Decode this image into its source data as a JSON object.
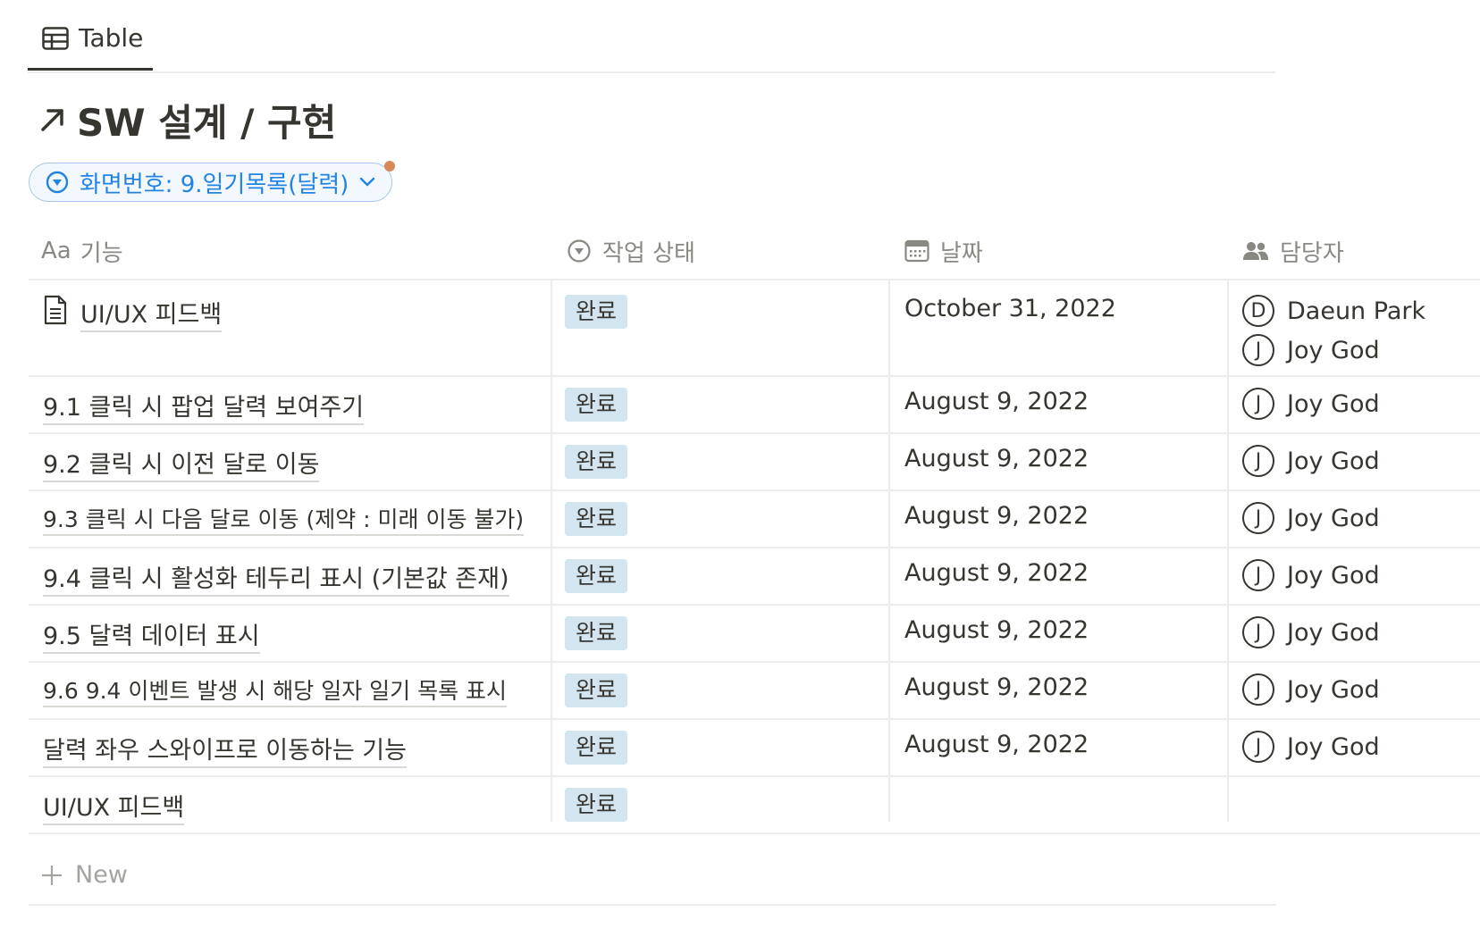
{
  "view_tab": {
    "label": "Table",
    "icon": "table-icon"
  },
  "page": {
    "title": "SW 설계 / 구현",
    "title_icon": "arrow-up-right-icon"
  },
  "filter": {
    "label": "화면번호: 9.일기목록(달력)",
    "icon": "select-circle-icon",
    "accent": "#2383e2",
    "indicator_color": "#d9885a"
  },
  "columns": [
    {
      "prefix": "Aa",
      "label": "기능",
      "icon": "title-property-icon"
    },
    {
      "label": "작업 상태",
      "icon": "status-property-icon"
    },
    {
      "label": "날짜",
      "icon": "calendar-icon"
    },
    {
      "label": "담당자",
      "icon": "people-icon"
    }
  ],
  "rows": [
    {
      "name": "UI/UX 피드백",
      "has_page_icon": true,
      "status": "완료",
      "date": "October 31, 2022",
      "assignees": [
        {
          "initial": "D",
          "name": "Daeun Park"
        },
        {
          "initial": "J",
          "name": "Joy God"
        }
      ]
    },
    {
      "name": "9.1 클릭 시 팝업 달력 보여주기",
      "status": "완료",
      "date": "August 9, 2022",
      "assignees": [
        {
          "initial": "J",
          "name": "Joy God"
        }
      ]
    },
    {
      "name": "9.2 클릭 시 이전 달로 이동",
      "status": "완료",
      "date": "August 9, 2022",
      "assignees": [
        {
          "initial": "J",
          "name": "Joy God"
        }
      ]
    },
    {
      "name": "9.3 클릭 시 다음 달로 이동 (제약 : 미래 이동 불가)",
      "status": "완료",
      "date": "August 9, 2022",
      "assignees": [
        {
          "initial": "J",
          "name": "Joy God"
        }
      ]
    },
    {
      "name": "9.4 클릭 시 활성화 테두리 표시 (기본값 존재)",
      "status": "완료",
      "date": "August 9, 2022",
      "assignees": [
        {
          "initial": "J",
          "name": "Joy God"
        }
      ]
    },
    {
      "name": "9.5 달력 데이터 표시",
      "status": "완료",
      "date": "August 9, 2022",
      "assignees": [
        {
          "initial": "J",
          "name": "Joy God"
        }
      ]
    },
    {
      "name": "9.6 9.4 이벤트 발생 시 해당 일자 일기 목록 표시",
      "status": "완료",
      "date": "August 9, 2022",
      "assignees": [
        {
          "initial": "J",
          "name": "Joy God"
        }
      ]
    },
    {
      "name": "달력 좌우 스와이프로 이동하는 기능",
      "status": "완료",
      "date": "August 9, 2022",
      "assignees": [
        {
          "initial": "J",
          "name": "Joy God"
        }
      ]
    },
    {
      "name": "UI/UX 피드백",
      "status": "완료",
      "date": "",
      "assignees": []
    }
  ],
  "new_row": {
    "label": "New",
    "icon": "plus-icon"
  },
  "colors": {
    "status_tag_bg": "#d3e5ef",
    "text": "#37352f",
    "muted": "#8a8883",
    "divider": "#ececeb"
  }
}
